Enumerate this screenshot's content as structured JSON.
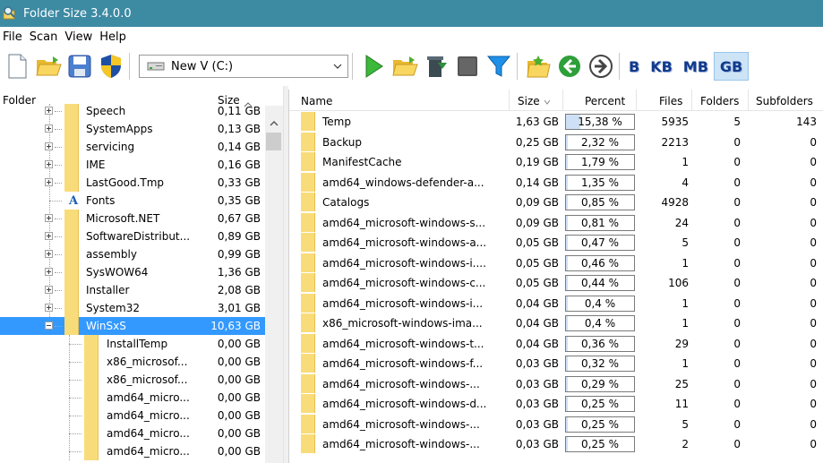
{
  "window": {
    "title": "Folder Size 3.4.0.0"
  },
  "menu": [
    "File",
    "Scan",
    "View",
    "Help"
  ],
  "toolbar": {
    "drive": "New V (C:)",
    "units": [
      "B",
      "KB",
      "MB",
      "GB"
    ],
    "active_unit": "GB",
    "icons": [
      "new-icon",
      "open-folder-icon",
      "save-icon",
      "shield-icon",
      "play-icon",
      "open-folder-icon",
      "delete-icon",
      "stop-icon",
      "filter-icon",
      "favorite-icon",
      "back-icon",
      "forward-icon"
    ]
  },
  "left": {
    "header_folder": "Folder",
    "header_size": "Size",
    "items": [
      {
        "name": "Speech",
        "size": "0,11 GB",
        "expandable": true,
        "level": 1
      },
      {
        "name": "SystemApps",
        "size": "0,13 GB",
        "expandable": true,
        "level": 1
      },
      {
        "name": "servicing",
        "size": "0,14 GB",
        "expandable": true,
        "level": 1
      },
      {
        "name": "IME",
        "size": "0,16 GB",
        "expandable": true,
        "level": 1
      },
      {
        "name": "LastGood.Tmp",
        "size": "0,33 GB",
        "expandable": true,
        "level": 1
      },
      {
        "name": "Fonts",
        "size": "0,35 GB",
        "expandable": false,
        "level": 1,
        "font_icon": true
      },
      {
        "name": "Microsoft.NET",
        "size": "0,67 GB",
        "expandable": true,
        "level": 1
      },
      {
        "name": "SoftwareDistribut...",
        "size": "0,89 GB",
        "expandable": true,
        "level": 1
      },
      {
        "name": "assembly",
        "size": "0,99 GB",
        "expandable": true,
        "level": 1
      },
      {
        "name": "SysWOW64",
        "size": "1,36 GB",
        "expandable": true,
        "level": 1
      },
      {
        "name": "Installer",
        "size": "2,08 GB",
        "expandable": true,
        "level": 1
      },
      {
        "name": "System32",
        "size": "3,01 GB",
        "expandable": true,
        "level": 1
      },
      {
        "name": "WinSxS",
        "size": "10,63 GB",
        "expandable": true,
        "expanded": true,
        "level": 1,
        "selected": true
      },
      {
        "name": "InstallTemp",
        "size": "0,00 GB",
        "expandable": false,
        "level": 2
      },
      {
        "name": "x86_microsof...",
        "size": "0,00 GB",
        "expandable": false,
        "level": 2
      },
      {
        "name": "x86_microsof...",
        "size": "0,00 GB",
        "expandable": false,
        "level": 2
      },
      {
        "name": "amd64_micro...",
        "size": "0,00 GB",
        "expandable": false,
        "level": 2
      },
      {
        "name": "amd64_micro...",
        "size": "0,00 GB",
        "expandable": false,
        "level": 2
      },
      {
        "name": "amd64_micro...",
        "size": "0,00 GB",
        "expandable": false,
        "level": 2
      },
      {
        "name": "amd64_micro...",
        "size": "0,00 GB",
        "expandable": false,
        "level": 2
      }
    ]
  },
  "right": {
    "columns": {
      "name": "Name",
      "size": "Size",
      "percent": "Percent",
      "files": "Files",
      "folders": "Folders",
      "subfolders": "Subfolders"
    },
    "rows": [
      {
        "name": "Temp",
        "size": "1,63 GB",
        "percent": "15,38 %",
        "pct": 15.38,
        "files": "5935",
        "folders": "5",
        "subfolders": "143"
      },
      {
        "name": "Backup",
        "size": "0,25 GB",
        "percent": "2,32 %",
        "pct": 2.32,
        "files": "2213",
        "folders": "0",
        "subfolders": "0"
      },
      {
        "name": "ManifestCache",
        "size": "0,19 GB",
        "percent": "1,79 %",
        "pct": 1.79,
        "files": "1",
        "folders": "0",
        "subfolders": "0"
      },
      {
        "name": "amd64_windows-defender-a...",
        "size": "0,14 GB",
        "percent": "1,35 %",
        "pct": 1.35,
        "files": "4",
        "folders": "0",
        "subfolders": "0"
      },
      {
        "name": "Catalogs",
        "size": "0,09 GB",
        "percent": "0,85 %",
        "pct": 0.85,
        "files": "4928",
        "folders": "0",
        "subfolders": "0"
      },
      {
        "name": "amd64_microsoft-windows-s...",
        "size": "0,09 GB",
        "percent": "0,81 %",
        "pct": 0.81,
        "files": "24",
        "folders": "0",
        "subfolders": "0"
      },
      {
        "name": "amd64_microsoft-windows-a...",
        "size": "0,05 GB",
        "percent": "0,47 %",
        "pct": 0.47,
        "files": "5",
        "folders": "0",
        "subfolders": "0"
      },
      {
        "name": "amd64_microsoft-windows-i....",
        "size": "0,05 GB",
        "percent": "0,46 %",
        "pct": 0.46,
        "files": "1",
        "folders": "0",
        "subfolders": "0"
      },
      {
        "name": "amd64_microsoft-windows-c...",
        "size": "0,05 GB",
        "percent": "0,44 %",
        "pct": 0.44,
        "files": "106",
        "folders": "0",
        "subfolders": "0"
      },
      {
        "name": "amd64_microsoft-windows-i...",
        "size": "0,04 GB",
        "percent": "0,4 %",
        "pct": 0.4,
        "files": "1",
        "folders": "0",
        "subfolders": "0"
      },
      {
        "name": "x86_microsoft-windows-ima...",
        "size": "0,04 GB",
        "percent": "0,4 %",
        "pct": 0.4,
        "files": "1",
        "folders": "0",
        "subfolders": "0"
      },
      {
        "name": "amd64_microsoft-windows-t...",
        "size": "0,04 GB",
        "percent": "0,36 %",
        "pct": 0.36,
        "files": "29",
        "folders": "0",
        "subfolders": "0"
      },
      {
        "name": "amd64_microsoft-windows-f...",
        "size": "0,03 GB",
        "percent": "0,32 %",
        "pct": 0.32,
        "files": "1",
        "folders": "0",
        "subfolders": "0"
      },
      {
        "name": "amd64_microsoft-windows-...",
        "size": "0,03 GB",
        "percent": "0,29 %",
        "pct": 0.29,
        "files": "25",
        "folders": "0",
        "subfolders": "0"
      },
      {
        "name": "amd64_microsoft-windows-d...",
        "size": "0,03 GB",
        "percent": "0,25 %",
        "pct": 0.25,
        "files": "11",
        "folders": "0",
        "subfolders": "0"
      },
      {
        "name": "amd64_microsoft-windows-...",
        "size": "0,03 GB",
        "percent": "0,25 %",
        "pct": 0.25,
        "files": "5",
        "folders": "0",
        "subfolders": "0"
      },
      {
        "name": "amd64_microsoft-windows-...",
        "size": "0,03 GB",
        "percent": "0,25 %",
        "pct": 0.25,
        "files": "2",
        "folders": "0",
        "subfolders": "0"
      }
    ]
  },
  "colors": {
    "titlebar": "#3d8aa3",
    "selection": "#3399ff",
    "folder": "#f9dc7a",
    "percent_fill": "#cde0f5",
    "unit_text": "#123a8c"
  }
}
